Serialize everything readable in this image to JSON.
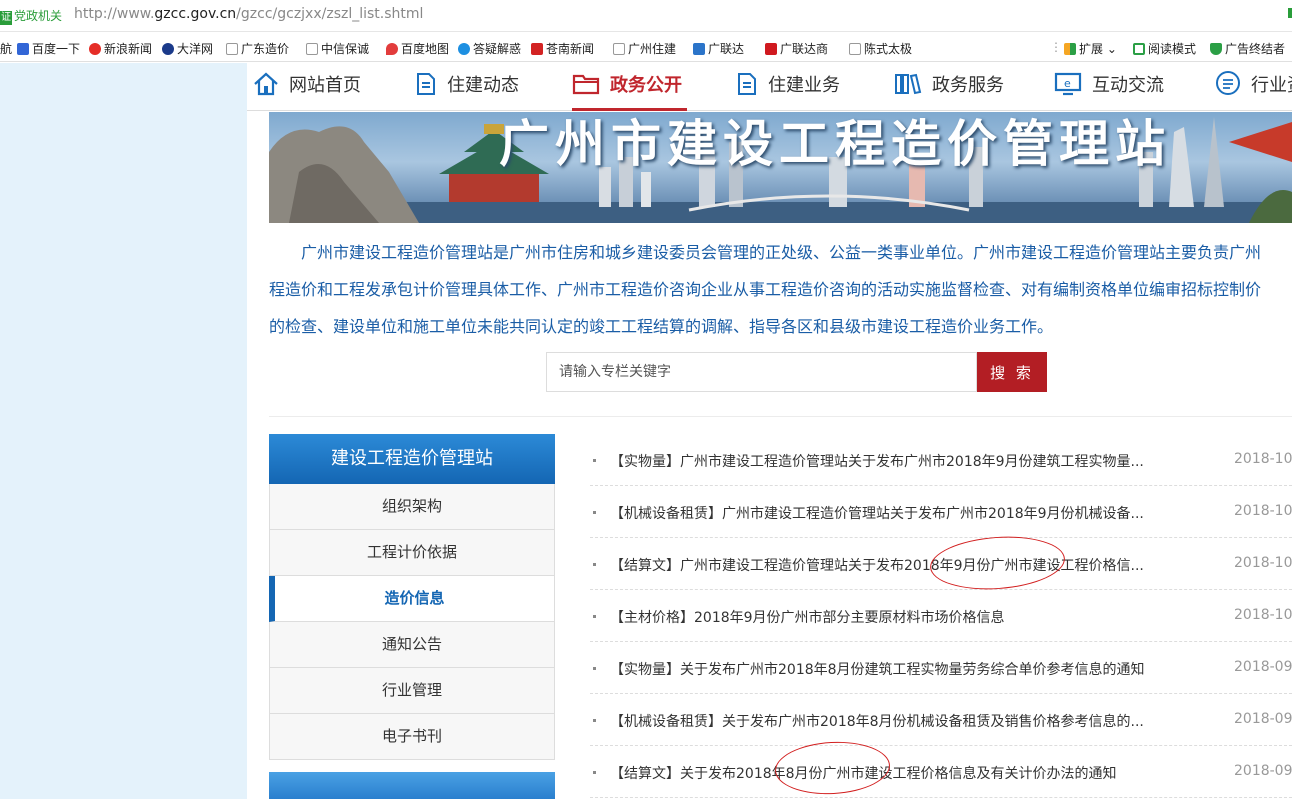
{
  "browser": {
    "badge": "党政机关",
    "url_prefix": "http://www.",
    "url_host": "gzcc.gov.cn",
    "url_path": "/gzcc/gczjxx/zszl_list.shtml",
    "bookmarks": [
      "航",
      "百度一下",
      "新浪新闻",
      "大洋网",
      "广东造价",
      "中信保诚",
      "百度地图",
      "答疑解惑",
      "苍南新闻",
      "广州住建",
      "广联达",
      "广联达商",
      "陈式太极"
    ],
    "right_items": [
      "扩展",
      "阅读模式",
      "广告终结者"
    ]
  },
  "nav": {
    "items": [
      "网站首页",
      "住建动态",
      "政务公开",
      "住建业务",
      "政务服务",
      "互动交流",
      "行业资"
    ]
  },
  "banner": {
    "title": "广州市建设工程造价管理站"
  },
  "intro": {
    "lines": [
      "广州市建设工程造价管理站是广州市住房和城乡建设委员会管理的正处级、公益一类事业单位。广州市建设工程造价管理站主要负责广州",
      "程造价和工程发承包计价管理具体工作、广州市工程造价咨询企业从事工程造价咨询的活动实施监督检查、对有编制资格单位编审招标控制价",
      "的检查、建设单位和施工单位未能共同认定的竣工工程结算的调解、指导各区和县级市建设工程造价业务工作。"
    ]
  },
  "search": {
    "placeholder": "请输入专栏关键字",
    "button": "搜 索"
  },
  "sidebar": {
    "title": "建设工程造价管理站",
    "items": [
      "组织架构",
      "工程计价依据",
      "造价信息",
      "通知公告",
      "行业管理",
      "电子书刊"
    ]
  },
  "list": [
    {
      "title": "【实物量】广州市建设工程造价管理站关于发布广州市2018年9月份建筑工程实物量...",
      "date": "2018-10"
    },
    {
      "title": "【机械设备租赁】广州市建设工程造价管理站关于发布广州市2018年9月份机械设备...",
      "date": "2018-10"
    },
    {
      "title": "【结算文】广州市建设工程造价管理站关于发布2018年9月份广州市建设工程价格信...",
      "date": "2018-10"
    },
    {
      "title": "【主材价格】2018年9月份广州市部分主要原材料市场价格信息",
      "date": "2018-10"
    },
    {
      "title": "【实物量】关于发布广州市2018年8月份建筑工程实物量劳务综合单价参考信息的通知",
      "date": "2018-09"
    },
    {
      "title": "【机械设备租赁】关于发布广州市2018年8月份机械设备租赁及销售价格参考信息的...",
      "date": "2018-09"
    },
    {
      "title": "【结算文】关于发布2018年8月份广州市建设工程价格信息及有关计价办法的通知",
      "date": "2018-09"
    }
  ],
  "colors": {
    "accent_red": "#c0262d",
    "brand_blue": "#1466b3",
    "intro_text": "#1a5da6"
  }
}
